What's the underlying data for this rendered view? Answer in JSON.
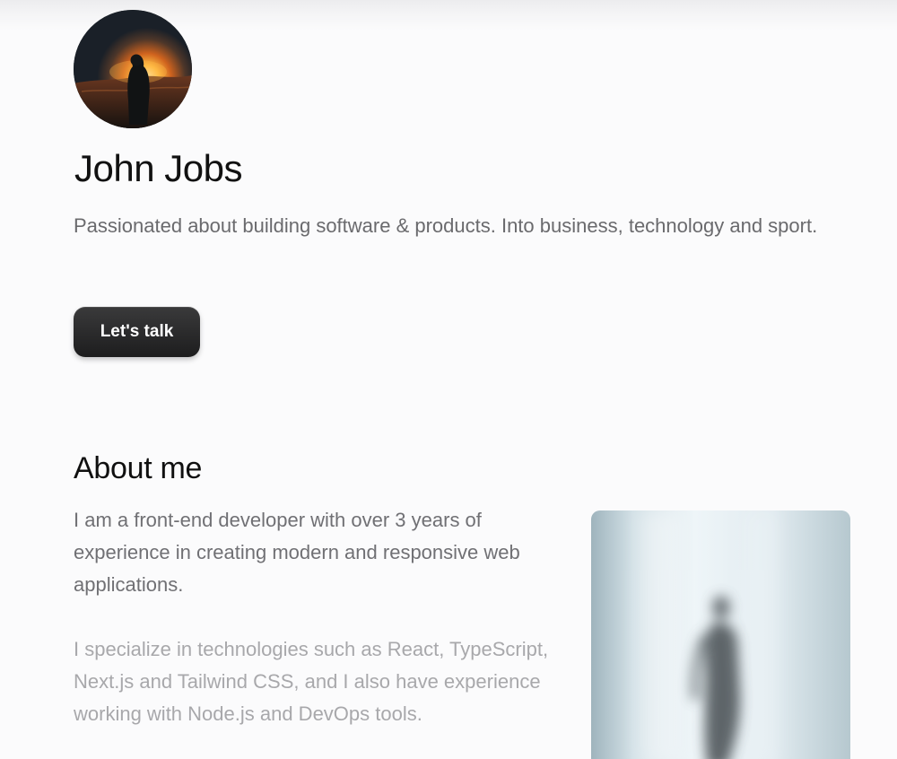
{
  "profile": {
    "name": "John Jobs",
    "bio": "Passionated about building software & products. Into business, technology and sport.",
    "cta_label": "Let's talk"
  },
  "about": {
    "title": "About me",
    "paragraphs": [
      "I am a front-end developer with over 3 years of experience in creating modern and responsive web applications.",
      "I specialize in technologies such as React, TypeScript, Next.js and Tailwind CSS, and I also have experience working with Node.js and DevOps tools."
    ]
  },
  "colors": {
    "background": "#fbfbfc",
    "heading": "#111111",
    "body_text": "#6a6a6d",
    "faded_text": "#a8a8ab",
    "button": "#262627",
    "button_text": "#ffffff"
  }
}
